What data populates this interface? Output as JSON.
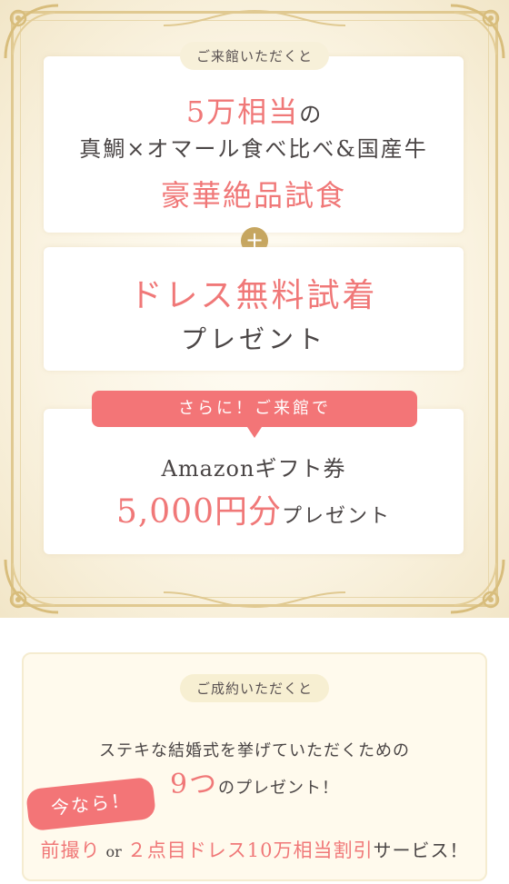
{
  "colors": {
    "accent_pink": "#f07878",
    "ribbon_pink": "#f37577",
    "gold": "#c6a660",
    "cream": "#faf3e1",
    "pill_bg": "#f7f0d9"
  },
  "visit_section": {
    "intro_pill": "ご来館いただくと",
    "offer1": {
      "amount": "5万相当",
      "particle": "の",
      "description": "真鯛×オマール食べ比べ&国産牛",
      "title": "豪華絶品試食"
    },
    "plus_icon": "plus-icon",
    "plus_symbol": "+",
    "offer2": {
      "title": "ドレス無料試着",
      "subtitle": "プレゼント"
    },
    "bonus": {
      "ribbon_label": "さらに！ご来館で",
      "item": "Amazonギフト券",
      "amount": "5,000円分",
      "suffix": "プレゼント"
    }
  },
  "contract_section": {
    "intro_pill": "ご成約いただくと",
    "line1": "ステキな結婚式を挙げていただくための",
    "count": "9つ",
    "count_suffix": "のプレゼント！",
    "badge": "今なら！",
    "service_a": "前撮り",
    "or": "or",
    "service_b": "２点目ドレス10万相当割引",
    "service_suffix": "サービス！"
  }
}
